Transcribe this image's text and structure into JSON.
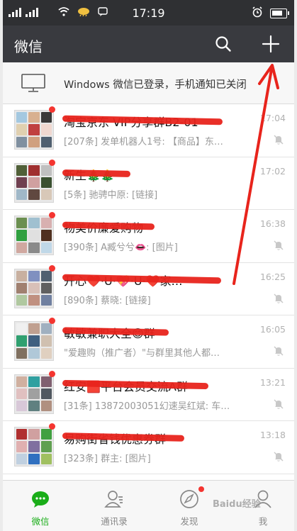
{
  "status_bar": {
    "time": "17:19"
  },
  "app_bar": {
    "title": "微信"
  },
  "notice": {
    "text": "Windows 微信已登录，手机通知已关闭"
  },
  "chats": [
    {
      "name": "淘宝京东 VIP分享群B2-01",
      "preview": "[207条] 发单机器人1号: 【商品】东…",
      "time": "17:04",
      "muted": true,
      "colors": [
        "#a4c8e0",
        "#d8b090",
        "#3a3a3a",
        "#e0d0b0",
        "#c04040",
        "#f0d8d0",
        "#8090a0",
        "#d0a080",
        "#506070"
      ]
    },
    {
      "name": "新生🎄🎄",
      "preview": "[5条] 驰骋中原: [链接]",
      "time": "17:02",
      "muted": false,
      "colors": [
        "#506038",
        "#a03030",
        "#c0c0c0",
        "#704050",
        "#d0a0a0",
        "#3a5030",
        "#a0b8c8",
        "#604840",
        "#d8c8b8"
      ]
    },
    {
      "name": "物美价廉爱购物",
      "preview": "[390条] A臧兮兮👄: [图片]",
      "time": "16:38",
      "muted": true,
      "colors": [
        "#6b8f50",
        "#a0c0d0",
        "#d8b0b0",
        "#30a040",
        "#e0e0e0",
        "#503020",
        "#d0a8a0",
        "#8a8a8a",
        "#c0d8e8"
      ]
    },
    {
      "name": "开心❤️·U·💖·U·❤️家…",
      "preview": "[890条] 蔡晓: [链接]",
      "time": "16:25",
      "muted": true,
      "colors": [
        "#c8b0a0",
        "#8090c0",
        "#506070",
        "#a08070",
        "#d8c0b8",
        "#606060",
        "#b0c8a0",
        "#c09080",
        "#7080a0"
      ]
    },
    {
      "name": "敏敏兼职大全😊群",
      "preview": "\"爱趣购（推广者）\"与群里其他人都…",
      "time": "16:05",
      "muted": true,
      "colors": [
        "#f0f0f0",
        "#c0a090",
        "#a0b0c0",
        "#30a070",
        "#406080",
        "#d0c0b0",
        "#807060",
        "#b0c8d8",
        "#e0d0c0"
      ]
    },
    {
      "name": "红安🟥平台会员交流A群",
      "preview": "[31条] 13872003051幻速吴红斌: 车…",
      "time": "13:21",
      "muted": true,
      "colors": [
        "#d0b0a0",
        "#30a0a0",
        "#806070",
        "#e0c0c0",
        "#a0a0a0",
        "#505860",
        "#d8c8d8",
        "#608080",
        "#b09080"
      ]
    },
    {
      "name": "易购街省钱优惠券群",
      "preview": "[323条] 群主: [图片]",
      "time": "13:18",
      "muted": true,
      "colors": [
        "#b03030",
        "#d0a0a0",
        "#40a040",
        "#e0b0b0",
        "#8070a0",
        "#60a050",
        "#c0d0e0",
        "#3070c0",
        "#a0c060"
      ]
    },
    {
      "name": "",
      "preview": "",
      "time": "",
      "muted": false,
      "colors": [
        "#3070c0",
        "#40a0d0",
        "#a0a0a0",
        "#d0d0d0",
        "#e0e0e0",
        "#b0b0b0",
        "#c0c0c0",
        "#d0d0d0",
        "#e0e0e0"
      ]
    }
  ],
  "tabs": [
    {
      "label": "微信",
      "icon": "chat-bubble-icon",
      "active": true
    },
    {
      "label": "通讯录",
      "icon": "contacts-icon",
      "active": false
    },
    {
      "label": "发现",
      "icon": "compass-icon",
      "active": false,
      "badge": true
    },
    {
      "label": "我",
      "icon": "person-icon",
      "active": false
    }
  ],
  "watermark": "Baidu经验",
  "colors": {
    "accent": "#1aad19",
    "badge": "#f43530",
    "header": "#393a3f",
    "annotation": "#e8241c"
  }
}
